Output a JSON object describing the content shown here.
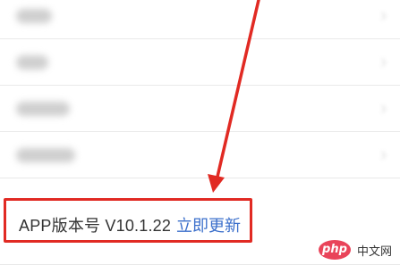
{
  "version_row": {
    "label": "APP版本号 V10.1.22",
    "update_link": "立即更新"
  },
  "watermark": {
    "logo": "php",
    "text": "中文网"
  },
  "colors": {
    "highlight": "#e12a23",
    "link": "#3b6fcb"
  }
}
